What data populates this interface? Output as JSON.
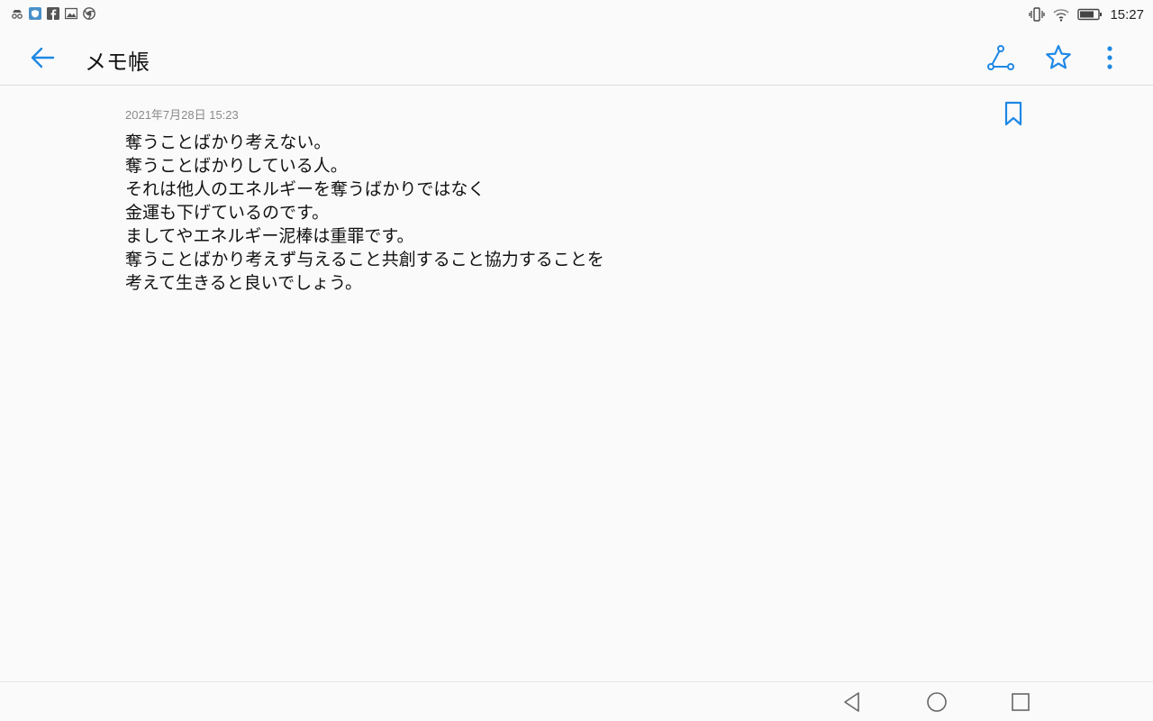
{
  "status_bar": {
    "time": "15:27",
    "left_icons": [
      "incognito-icon",
      "shield-app-icon",
      "facebook-icon",
      "gallery-app-icon",
      "chrome-icon"
    ],
    "right_icons": [
      "vibrate-icon",
      "wifi-icon",
      "battery-icon"
    ]
  },
  "toolbar": {
    "title": "メモ帳",
    "back_icon": "arrow-left-icon",
    "actions": [
      "share-icon",
      "star-icon",
      "more-vert-icon"
    ]
  },
  "note": {
    "date": "2021年7月28日 15:23",
    "lines": [
      "奪うことばかり考えない。",
      "奪うことばかりしている人。",
      "それは他人のエネルギーを奪うばかりではなく",
      "金運も下げているのです。",
      "ましてやエネルギー泥棒は重罪です。",
      "奪うことばかり考えず与えること共創すること協力することを",
      "考えて生きると良いでしょう。"
    ]
  },
  "nav_bar": {
    "icons": [
      "nav-back-icon",
      "nav-home-icon",
      "nav-recents-icon"
    ]
  },
  "colors": {
    "accent": "#1e88e5",
    "background": "#fafafa",
    "date_text": "#8a8a8a"
  }
}
